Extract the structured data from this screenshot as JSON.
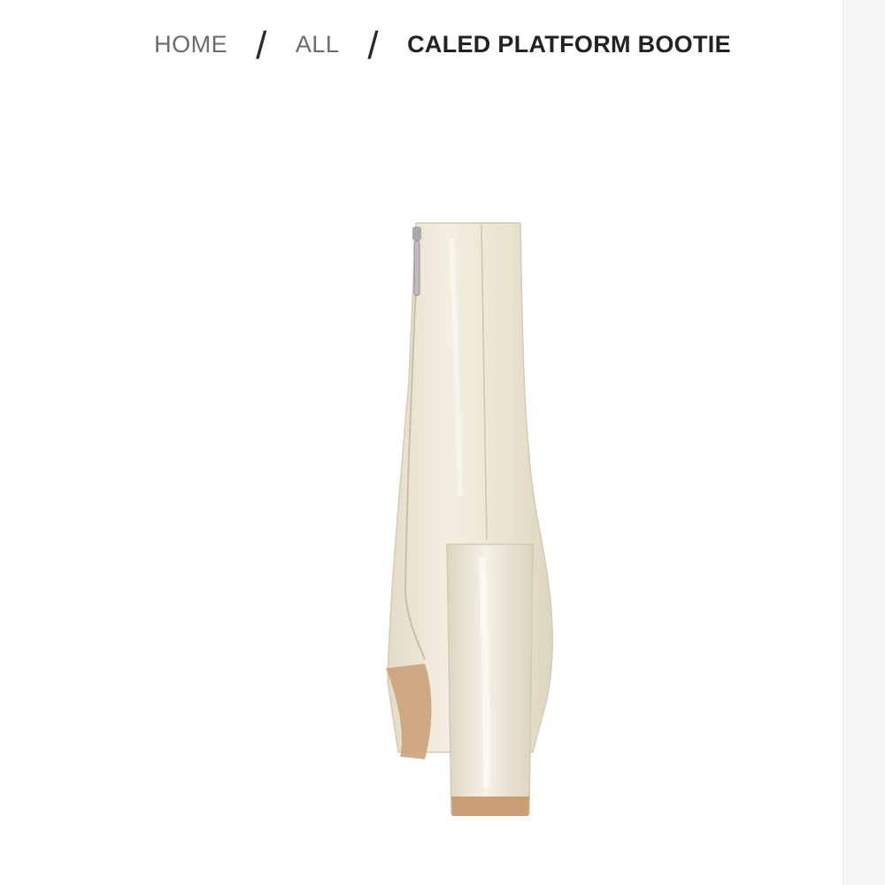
{
  "breadcrumb": {
    "items": [
      {
        "label": "HOME"
      },
      {
        "label": "ALL"
      },
      {
        "label": "CALED PLATFORM BOOTIE"
      }
    ],
    "separator": "/"
  },
  "product": {
    "image_icon": "boot-image",
    "colors": {
      "boot": "#ece6d4",
      "sole": "#c99e74"
    }
  }
}
